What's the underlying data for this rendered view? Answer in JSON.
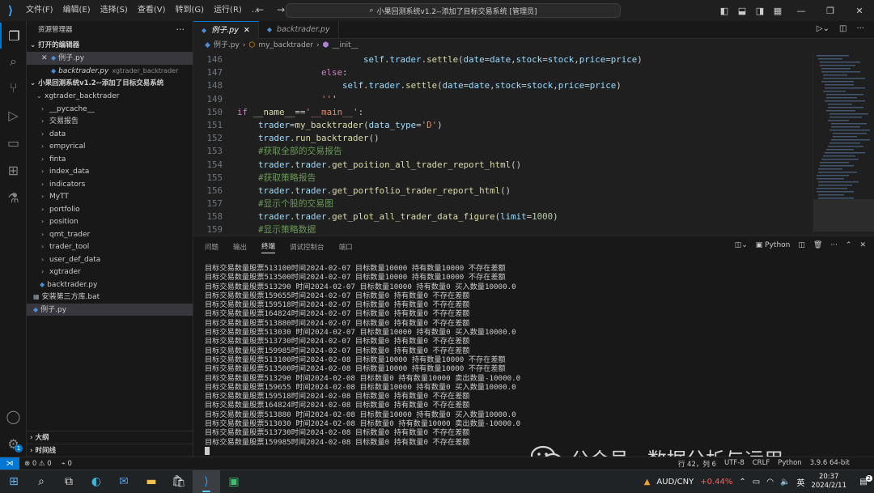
{
  "titlebar": {
    "menu": [
      "文件(F)",
      "编辑(E)",
      "选择(S)",
      "查看(V)",
      "转到(G)",
      "运行(R)",
      "…"
    ],
    "back": "←",
    "forward": "→",
    "search_text": "小果回测系统v1.2--添加了目标交易系统 [管理员]"
  },
  "sidebar": {
    "title": "资源管理器",
    "open_editors_label": "打开的编辑器",
    "open_editors": [
      {
        "name": "例子.py",
        "desc": ""
      },
      {
        "name": "backtrader.py",
        "desc": "xgtrader_backtrader"
      }
    ],
    "workspace_label": "小果回测系统v1.2--添加了目标交易系统",
    "root_folder": "xgtrader_backtrader",
    "folders": [
      "__pycache__",
      "交易报告",
      "data",
      "empyrical",
      "finta",
      "index_data",
      "indicators",
      "MyTT",
      "portfolio",
      "position",
      "qmt_trader",
      "trader_tool",
      "user_def_data",
      "xgtrader"
    ],
    "files": [
      "backtrader.py"
    ],
    "root_files": [
      "安装第三方库.bat",
      "例子.py"
    ],
    "outline_label": "大纲",
    "timeline_label": "时间线"
  },
  "editor": {
    "tabs": [
      {
        "label": "例子.py"
      },
      {
        "label": "backtrader.py"
      }
    ],
    "breadcrumb": [
      "例子.py",
      "my_backtrader",
      "__init__"
    ],
    "lines": [
      {
        "n": "146",
        "t": "                        self.trader.settle(date=date,stock=stock,price=price)"
      },
      {
        "n": "147",
        "t": "                else:"
      },
      {
        "n": "148",
        "t": "                    self.trader.settle(date=date,stock=stock,price=price)"
      },
      {
        "n": "149",
        "t": "                '''"
      },
      {
        "n": "150",
        "t": "if __name__=='__main__':"
      },
      {
        "n": "151",
        "t": "    trader=my_backtrader(data_type='D')"
      },
      {
        "n": "152",
        "t": "    trader.run_backtrader()"
      },
      {
        "n": "153",
        "t": "    #获取全部的交易报告"
      },
      {
        "n": "154",
        "t": "    trader.trader.get_poition_all_trader_report_html()"
      },
      {
        "n": "155",
        "t": "    #获取策略报告"
      },
      {
        "n": "156",
        "t": "    trader.trader.get_portfolio_trader_report_html()"
      },
      {
        "n": "157",
        "t": "    #显示个股的交易图"
      },
      {
        "n": "158",
        "t": "    trader.trader.get_plot_all_trader_data_figure(limit=1000)"
      },
      {
        "n": "159",
        "t": "    #显示策略数据"
      }
    ]
  },
  "panel": {
    "tabs": [
      "问题",
      "输出",
      "终端",
      "调试控制台",
      "端口"
    ],
    "active_tab": "终端",
    "shell": "Python",
    "terminal_lines": [
      "目标交易数量股票513100时间2024-02-07 目标数量10000 持有数量10000 不存在差额",
      "目标交易数量股票513500时间2024-02-07 目标数量10000 持有数量10000 不存在差额",
      "目标交易数量股票513290 时间2024-02-07 目标数量10000 持有数量0 买入数量10000.0",
      "目标交易数量股票159655时间2024-02-07 目标数量0 持有数量0 不存在差额",
      "目标交易数量股票159518时间2024-02-07 目标数量0 持有数量0 不存在差额",
      "目标交易数量股票164824时间2024-02-07 目标数量0 持有数量0 不存在差额",
      "目标交易数量股票513880时间2024-02-07 目标数量0 持有数量0 不存在差额",
      "目标交易数量股票513030 时间2024-02-07 目标数量10000 持有数量0 买入数量10000.0",
      "目标交易数量股票513730时间2024-02-07 目标数量0 持有数量0 不存在差额",
      "目标交易数量股票159985时间2024-02-07 目标数量0 持有数量0 不存在差额",
      "目标交易数量股票513100时间2024-02-08 目标数量10000 持有数量10000 不存在差额",
      "目标交易数量股票513500时间2024-02-08 目标数量10000 持有数量10000 不存在差额",
      "目标交易数量股票513290 时间2024-02-08 目标数量0 持有数量10000 卖出数量-10000.0",
      "目标交易数量股票159655 时间2024-02-08 目标数量10000 持有数量0 买入数量10000.0",
      "目标交易数量股票159518时间2024-02-08 目标数量0 持有数量0 不存在差额",
      "目标交易数量股票164824时间2024-02-08 目标数量0 持有数量0 不存在差额",
      "目标交易数量股票513880 时间2024-02-08 目标数量10000 持有数量0 买入数量10000.0",
      "目标交易数量股票513030 时间2024-02-08 目标数量0 持有数量10000 卖出数量-10000.0",
      "目标交易数量股票513730时间2024-02-08 目标数量0 持有数量0 不存在差额",
      "目标交易数量股票159985时间2024-02-08 目标数量0 持有数量0 不存在差额"
    ]
  },
  "watermark": "公众号 · 数据分析与运用",
  "statusbar": {
    "problems": "⊗ 0 ⚠ 0",
    "ports": "⌁ 0",
    "right_items": [
      "行 42，列 6",
      "UTF-8",
      "CRLF",
      "Python",
      "3.9.6 64-bit"
    ]
  },
  "taskbar": {
    "stock": "AUD/CNY",
    "change": "+0.44%",
    "ime": "英",
    "time": "20:37",
    "date": "2024/2/11",
    "notif_count": "2"
  },
  "colors": {
    "accent": "#0078d4",
    "stock_up": "#ff5f5f"
  }
}
